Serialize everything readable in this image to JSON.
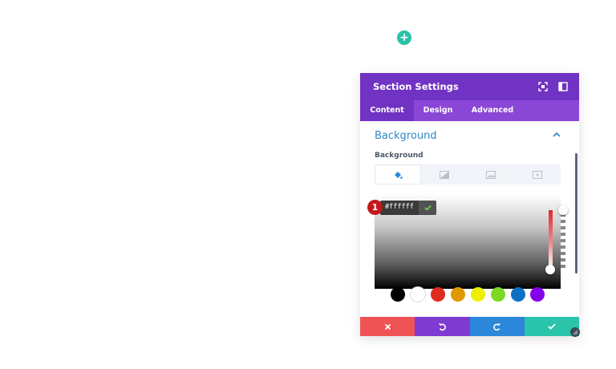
{
  "canvas": {
    "add_button_symbol": "+"
  },
  "modal": {
    "title": "Section Settings",
    "tabs": [
      {
        "label": "Content",
        "active": true
      },
      {
        "label": "Design",
        "active": false
      },
      {
        "label": "Advanced",
        "active": false
      }
    ],
    "section": {
      "title": "Background",
      "field_label": "Background",
      "background_types": [
        {
          "icon": "paint-bucket-icon",
          "active": true
        },
        {
          "icon": "gradient-icon",
          "active": false
        },
        {
          "icon": "image-icon",
          "active": false
        },
        {
          "icon": "video-icon",
          "active": false
        }
      ]
    },
    "color_picker": {
      "hex_value": "#ffffff",
      "step_badge": "1",
      "swatches": [
        "#000000",
        "#ffffff",
        "#e02b20",
        "#e09900",
        "#edf000",
        "#7cda24",
        "#0c71c3",
        "#8300e9"
      ]
    },
    "footer": {
      "cancel_icon": "close-icon",
      "undo_icon": "undo-icon",
      "redo_icon": "redo-icon",
      "save_icon": "check-icon"
    }
  },
  "colors": {
    "header_purple": "#7133c3",
    "tab_purple": "#8a47d5",
    "title_blue": "#2d89c4",
    "cancel_red": "#ef5354",
    "undo_purple": "#7e3bd0",
    "redo_blue": "#2b87da",
    "save_green": "#29c4a9",
    "add_teal": "#2bc0a8"
  }
}
